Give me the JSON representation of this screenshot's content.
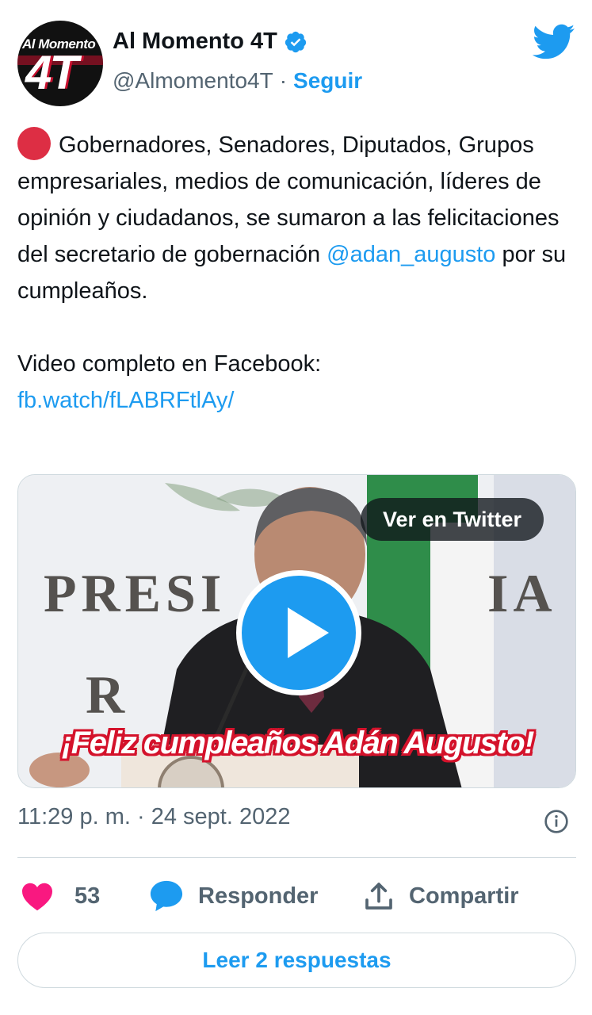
{
  "header": {
    "avatar_top_text": "Al Momento",
    "avatar_big_text": "4T",
    "display_name": "Al Momento 4T",
    "handle": "@Almomento4T",
    "separator": "·",
    "follow_label": "Seguir"
  },
  "body": {
    "emoji": "red-circle",
    "text_1": "Gobernadores, Senadores, Diputados, Grupos empresariales, medios de comunicación, líderes de opinión y ciudadanos, se sumaron a las felicitaciones del secretario de gobernación ",
    "mention": "@adan_augusto",
    "text_2": " por su cumpleaños.",
    "video_intro": "Video completo en Facebook:",
    "link": "fb.watch/fLABRFtlAy/"
  },
  "media": {
    "button_label": "Ver en Twitter",
    "caption": "¡Feliz cumpleaños Adán Augusto!",
    "background_text_left": "PRESI",
    "background_text_right": "IA"
  },
  "meta": {
    "time": "11:29 p. m.",
    "separator": "·",
    "date": "24 sept. 2022"
  },
  "actions": {
    "likes_count": "53",
    "reply_label": "Responder",
    "share_label": "Compartir",
    "read_replies_label": "Leer 2 respuestas"
  },
  "colors": {
    "accent": "#1d9bf0",
    "like": "#f91880",
    "secondary_text": "#536471"
  }
}
